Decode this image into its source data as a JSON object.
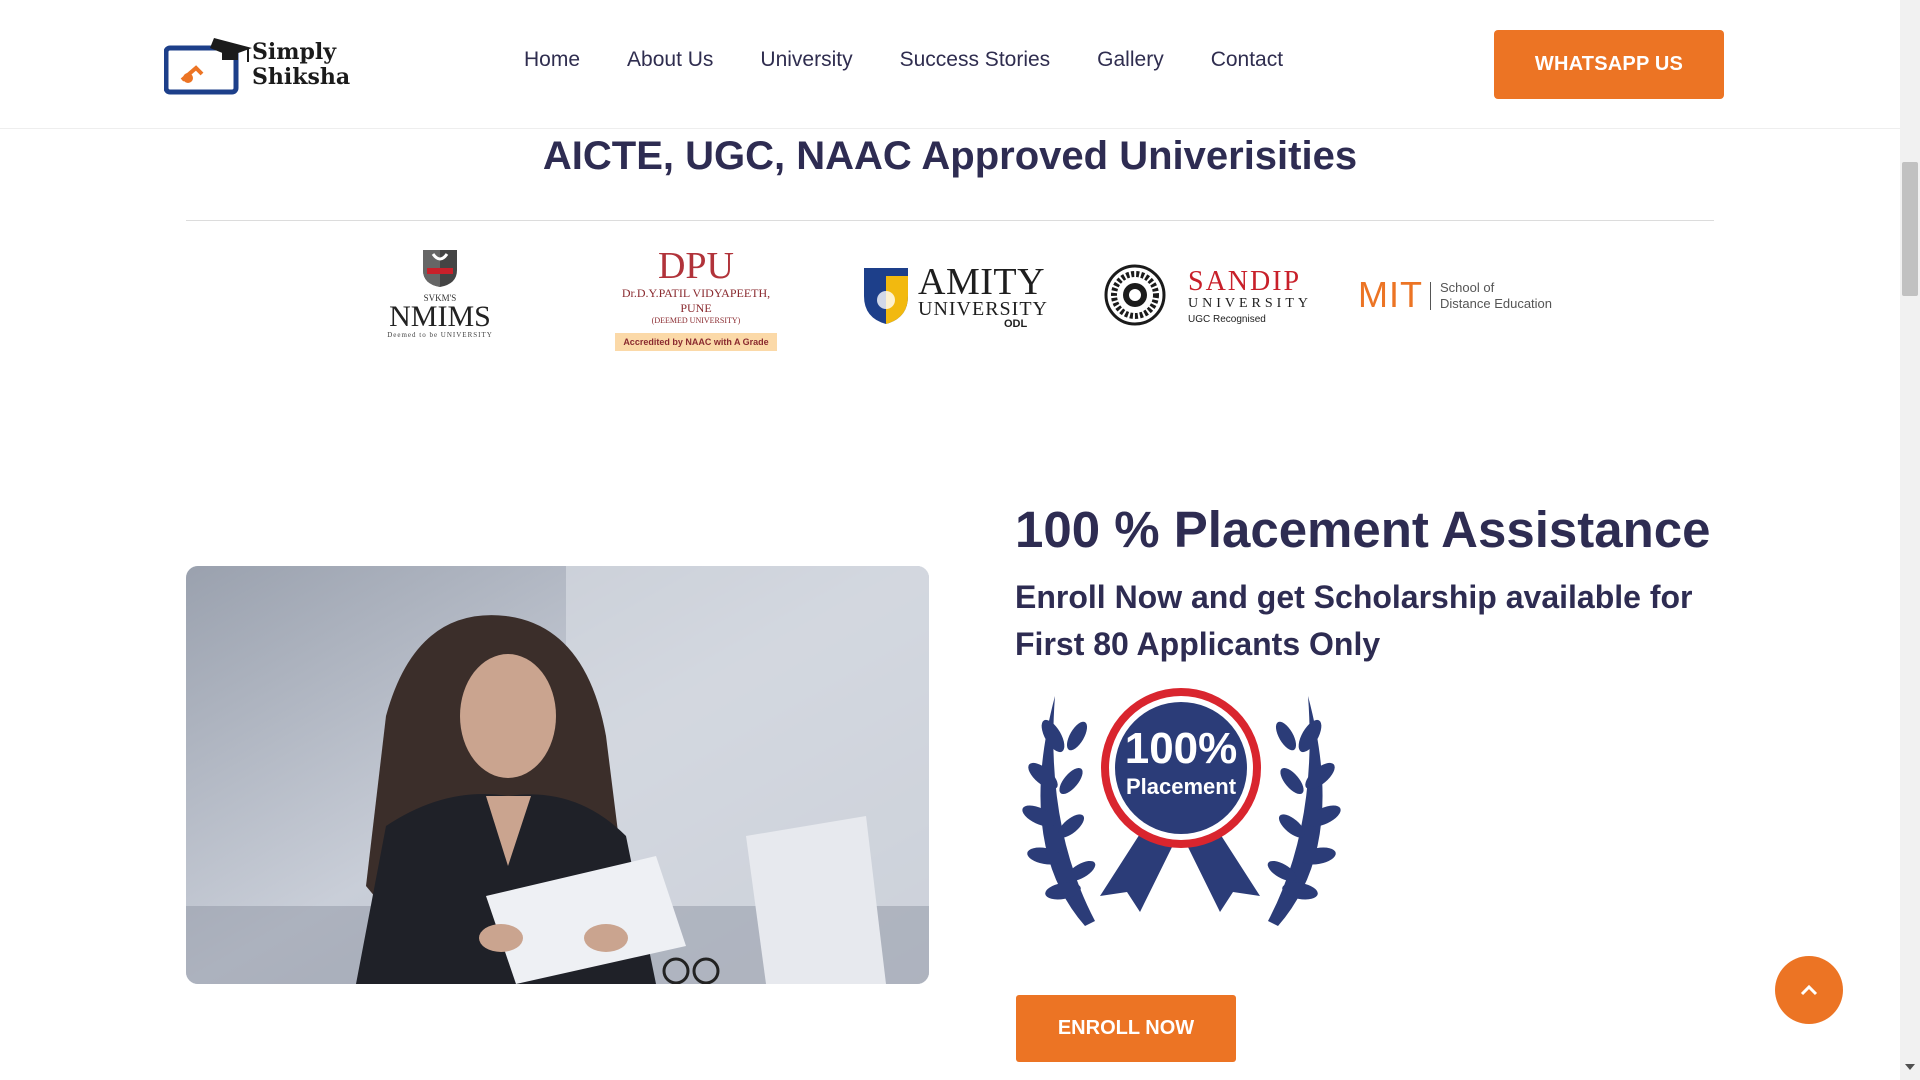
{
  "header": {
    "logo": {
      "line1": "Simply",
      "line2": "Shiksha"
    },
    "nav": [
      "Home",
      "About Us",
      "University",
      "Success Stories",
      "Gallery",
      "Contact"
    ],
    "whatsapp_label": "WHATSAPP US"
  },
  "approved": {
    "title": "AICTE, UGC, NAAC Approved Univerisities",
    "logos": {
      "nmims": {
        "small": "SVKM'S",
        "name": "NMIMS",
        "tiny": "Deemed to be UNIVERSITY"
      },
      "dpu": {
        "name": "DPU",
        "line": "Dr.D.Y.PATIL VIDYAPEETH, PUNE",
        "sub": "(DEEMED UNIVERSITY)",
        "accreditation": "Accredited by NAAC with A Grade"
      },
      "amity": {
        "name": "AMITY",
        "univ": "UNIVERSITY",
        "odl": "ODL"
      },
      "sandip": {
        "name": "SANDIP",
        "univ": "UNIVERSITY",
        "ugc": "UGC Recognised"
      },
      "mit": {
        "name": "MIT",
        "line1": "School of",
        "line2": "Distance Education"
      }
    }
  },
  "placement": {
    "title": "100 % Placement Assistance",
    "subtitle": "Enroll Now and get Scholarship available for First 80 Applicants Only",
    "badge": {
      "percent": "100%",
      "label": "Placement"
    },
    "enroll_label": "ENROLL NOW"
  },
  "colors": {
    "accent": "#ec7424",
    "heading": "#2e2c52",
    "badge_blue": "#2b3c78",
    "badge_red": "#d9252e"
  },
  "icons": {
    "scroll_top": "chevron-up-icon"
  }
}
